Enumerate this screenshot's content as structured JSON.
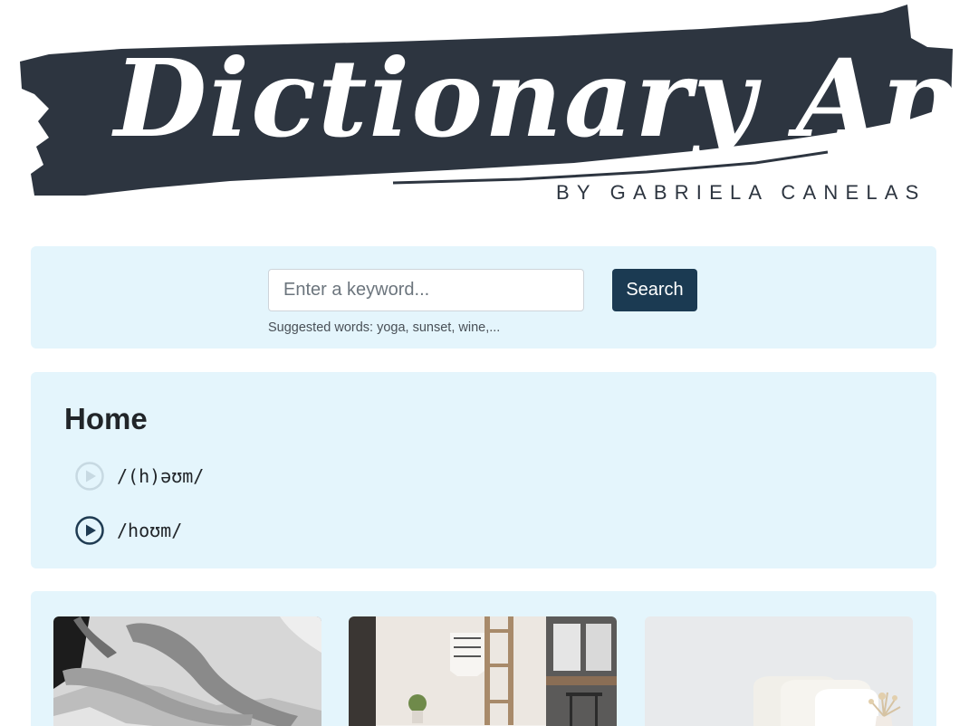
{
  "logo": {
    "title": "Dictionary App",
    "subtitle": "BY GABRIELA CANELAS"
  },
  "search": {
    "placeholder": "Enter a keyword...",
    "value": "",
    "button_label": "Search",
    "hint": "Suggested words: yoga, sunset, wine,..."
  },
  "result": {
    "word": "Home",
    "phonetics": [
      {
        "text": "/(h)əʊm/",
        "audio_available": false
      },
      {
        "text": "/hoʊm/",
        "audio_available": true
      }
    ]
  },
  "photos": [
    {
      "icon": "photo-bedroom-bw"
    },
    {
      "icon": "photo-living-room-ladder"
    },
    {
      "icon": "photo-bed-pillows"
    }
  ],
  "colors": {
    "brand_dark": "#2d3540",
    "button": "#1b3a52",
    "panel_bg": "#e4f5fc",
    "play_active": "#1f3b52",
    "play_disabled": "#c7d9e2"
  }
}
